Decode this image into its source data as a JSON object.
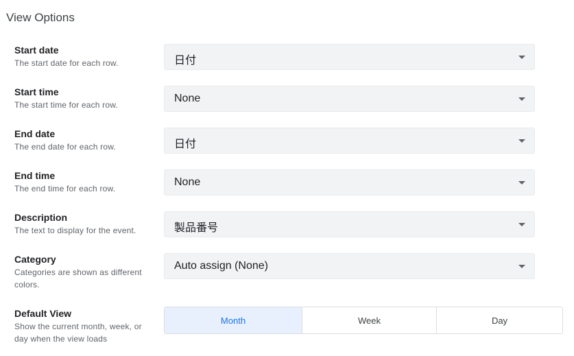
{
  "section_title": "View Options",
  "fields": [
    {
      "label": "Start date",
      "description": "The start date for each row.",
      "value": "日付"
    },
    {
      "label": "Start time",
      "description": "The start time for each row.",
      "value": "None"
    },
    {
      "label": "End date",
      "description": "The end date for each row.",
      "value": "日付"
    },
    {
      "label": "End time",
      "description": "The end time for each row.",
      "value": "None"
    },
    {
      "label": "Description",
      "description": "The text to display for the event.",
      "value": "製品番号"
    },
    {
      "label": "Category",
      "description_line1": "Categories are shown as different",
      "description_line2": "colors.",
      "value": "Auto assign (None)"
    }
  ],
  "default_view": {
    "label": "Default View",
    "description_line1": "Show the current month, week, or",
    "description_line2": "day when the view loads",
    "options": [
      "Month",
      "Week",
      "Day"
    ],
    "selected": "Month"
  },
  "colors": {
    "accent": "#1a73e8",
    "selected_bg": "#e8f0fe",
    "field_bg": "#f1f3f4"
  },
  "icons": {
    "dropdown": "chevron-down-icon"
  }
}
